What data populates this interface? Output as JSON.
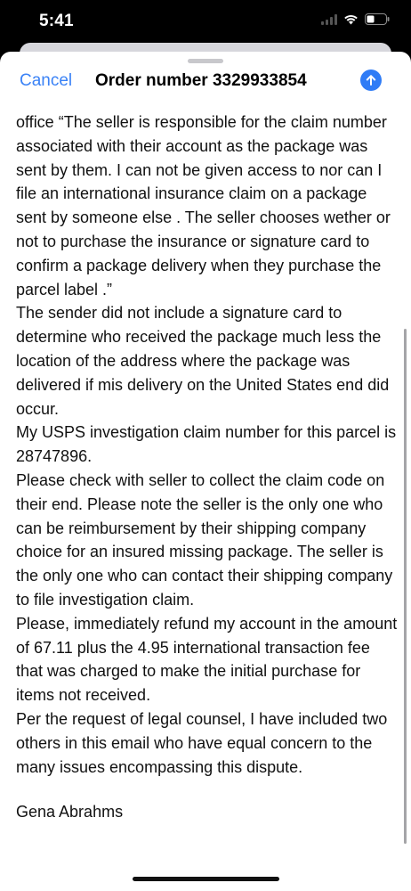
{
  "status_bar": {
    "time": "5:41",
    "icons": [
      "signal-icon",
      "wifi-icon",
      "battery-icon"
    ]
  },
  "nav": {
    "cancel_label": "Cancel",
    "title": "Order number 3329933854",
    "send_icon": "arrow-up-icon",
    "accent_color": "#2f7cf6"
  },
  "message": {
    "body": " office “The seller is responsible for the claim number associated with their account as the package was sent by them. I can not be given access to nor can I file an international insurance claim on a package sent by someone else . The seller chooses wether or not to purchase the insurance or signature card to confirm a package delivery when they purchase the parcel label .”\nThe sender did not include a signature card to determine who received the package much less the location of the address where the package was delivered if mis delivery on the United States end did occur.\nMy USPS investigation claim number for this parcel is 28747896.\nPlease check with seller to collect the claim code on their end. Please note the seller is the only one who can be reimbursement by their shipping company choice for an insured missing package. The seller is the only one who can contact their shipping company to file investigation claim.\nPlease, immediately refund my account in the amount of 67.11 plus the 4.95 international transaction fee that was charged to make the initial purchase for items not received.\nPer the request of legal counsel, I have included two others in this email who have equal concern to the many issues encompassing this dispute.",
    "signature": "Gena Abrahms"
  }
}
